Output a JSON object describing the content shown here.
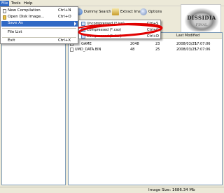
{
  "menubar": {
    "file": "File",
    "tools": "Tools",
    "help": "Help"
  },
  "toolbar": {
    "dummy_search": "Dummy Search",
    "extract_image": "Extract Image",
    "options": "Options"
  },
  "logo": {
    "title": "DISSIDIA",
    "sub": "FINAL"
  },
  "file_menu": {
    "new_compilation": {
      "label": "New Compilation",
      "shortcut": "Ctrl+N"
    },
    "open_disk_image": {
      "label": "Open Disk Image...",
      "shortcut": "Ctrl+O"
    },
    "save_as": {
      "label": "Save As"
    },
    "file_list": {
      "label": "File List"
    },
    "exit": {
      "label": "Exit",
      "shortcut": "Ctrl+X"
    }
  },
  "submenu": {
    "uncompressed": {
      "label": "Uncompressed (*.iso)",
      "shortcut": "Ctrl+S"
    },
    "compressed": {
      "label": "Compressed (*.cso)",
      "shortcut": "Ctrl+C"
    },
    "compressed2": {
      "label": "Compressed (*.dax)",
      "shortcut": "Ctrl+D"
    }
  },
  "list": {
    "headers": {
      "last_modified": "Last Modified"
    },
    "rows": [
      {
        "name": "GAME",
        "size": "2048",
        "lba": "23",
        "date": "2008/03/25",
        "time": "17:07:06"
      },
      {
        "name": "UMD_DATA.BIN",
        "size": "48",
        "lba": "25",
        "date": "2008/03/25",
        "time": "17:07:06"
      }
    ]
  },
  "status": {
    "image_size": "Image Size: 1686.34 Mb"
  },
  "colors": {
    "highlight": "#316ac5",
    "annotation": "#e00000"
  }
}
